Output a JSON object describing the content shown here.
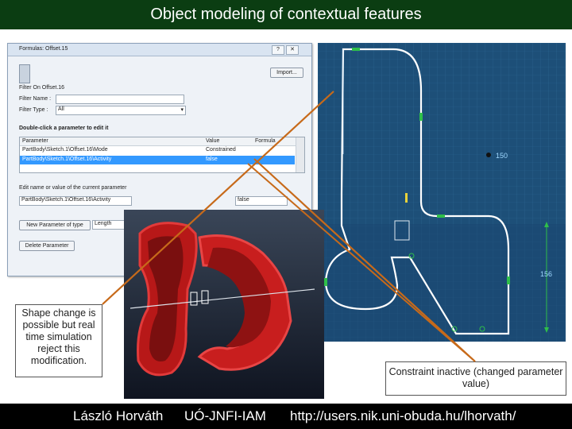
{
  "slide": {
    "title": "Object modeling of contextual features",
    "footer": {
      "author": "László Horváth",
      "institute": "UÓ-JNFI-IAM",
      "url": "http://users.nik.uni-obuda.hu/lhorvath/"
    }
  },
  "dialog": {
    "title": "Formulas: Offset.15",
    "import_label": "Import...",
    "filter_on_label": "Filter On Offset.16",
    "filter_name_label": "Filter Name :",
    "filter_type_label": "Filter Type :",
    "filter_type_value": "All",
    "instruction": "Double-click a parameter to edit it",
    "columns": [
      "Parameter",
      "Value",
      "Formula"
    ],
    "rows": [
      {
        "parameter": "PartBody\\Sketch.1\\Offset.16\\Mode",
        "value": "Constrained",
        "selected": false
      },
      {
        "parameter": "PartBody\\Sketch.1\\Offset.16\\Activity",
        "value": "false",
        "selected": true
      }
    ],
    "edit_label": "Edit name or value of the current parameter",
    "edit_name_value": "PartBody\\Sketch.1\\Offset.16\\Activity",
    "edit_value": "false",
    "new_param_label": "New Parameter of type",
    "type_value": "Length",
    "delete_label": "Delete Parameter"
  },
  "sketch": {
    "dimension_1": "150",
    "dimension_2": "156"
  },
  "callouts": {
    "left": "Shape change is possible but real time simulation reject this modification.",
    "right": "Constraint inactive (changed parameter value)"
  },
  "colors": {
    "title_bg": "#0b3d12",
    "arrow": "#c76a1a",
    "model_red": "#c81e1e",
    "sketch_bg": "#1d4f78",
    "selection": "#3399ff"
  }
}
